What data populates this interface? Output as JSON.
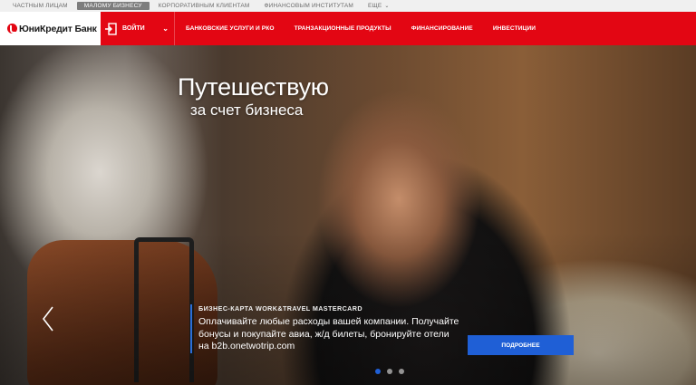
{
  "segments": [
    {
      "label": "Частным лицам",
      "active": false
    },
    {
      "label": "Малому бизнесу",
      "active": true
    },
    {
      "label": "Корпоративным клиентам",
      "active": false
    },
    {
      "label": "Финансовым институтам",
      "active": false
    },
    {
      "label": "Еще",
      "active": false
    }
  ],
  "header": {
    "logo_text": "ЮниКредит Банк",
    "login_label": "ВОЙТИ",
    "nav": [
      "Банковские услуги и РКО",
      "Транзакционные продукты",
      "Финансирование",
      "Инвестиции"
    ]
  },
  "hero": {
    "title": "Путешествую",
    "subtitle": "за счет бизнеса",
    "promo_kicker": "БИЗНЕС-КАРТА WORK&TRAVEL MASTERCARD",
    "promo_text": "Оплачивайте любые расходы вашей компании. Получайте бонусы и покупайте авиа, ж/д билеты, бронируйте отели на b2b.onetwotrip.com",
    "button_label": "ПОДРОБНЕЕ",
    "slides_total": 3,
    "slide_active": 1
  },
  "colors": {
    "brand_red": "#e30613",
    "accent_blue": "#1f5fd6"
  }
}
